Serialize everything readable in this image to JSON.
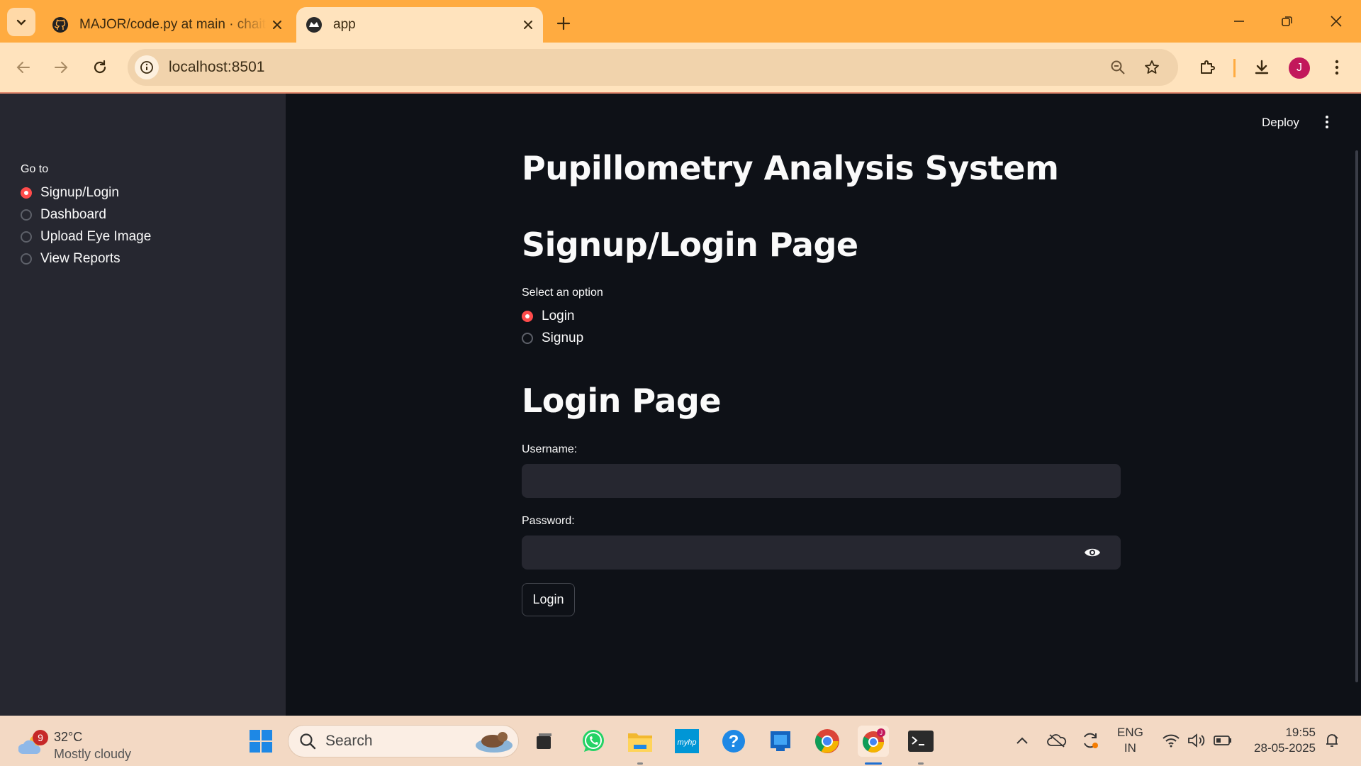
{
  "browser": {
    "tabs": [
      {
        "title": "MAJOR/code.py at main · chaitanya",
        "favicon": "github-icon",
        "active": false
      },
      {
        "title": "app",
        "favicon": "streamlit-icon",
        "active": true
      }
    ],
    "url": "localhost:8501",
    "profile_initial": "J",
    "theme_color": "#ffab40"
  },
  "sidebar": {
    "label": "Go to",
    "items": [
      {
        "label": "Signup/Login",
        "checked": true
      },
      {
        "label": "Dashboard",
        "checked": false
      },
      {
        "label": "Upload Eye Image",
        "checked": false
      },
      {
        "label": "View Reports",
        "checked": false
      }
    ]
  },
  "header": {
    "deploy_label": "Deploy"
  },
  "main": {
    "title": "Pupillometry Analysis System",
    "subheader": "Signup/Login Page",
    "option_label": "Select an option",
    "options": [
      {
        "label": "Login",
        "checked": true
      },
      {
        "label": "Signup",
        "checked": false
      }
    ],
    "form_title": "Login Page",
    "username_label": "Username:",
    "username_value": "",
    "password_label": "Password:",
    "password_value": "",
    "login_button": "Login",
    "accent_color": "#ff4b4b"
  },
  "taskbar": {
    "weather": {
      "temp": "32°C",
      "condition": "Mostly cloudy",
      "badge": "9"
    },
    "search_label": "Search",
    "apps": [
      "start-icon",
      "task-view-icon",
      "whatsapp-icon",
      "file-explorer-icon",
      "myhp-icon",
      "help-icon",
      "store-icon",
      "chrome-icon",
      "chrome-profile-icon",
      "terminal-icon"
    ],
    "language": {
      "line1": "ENG",
      "line2": "IN"
    },
    "time": "19:55",
    "date": "28-05-2025"
  }
}
